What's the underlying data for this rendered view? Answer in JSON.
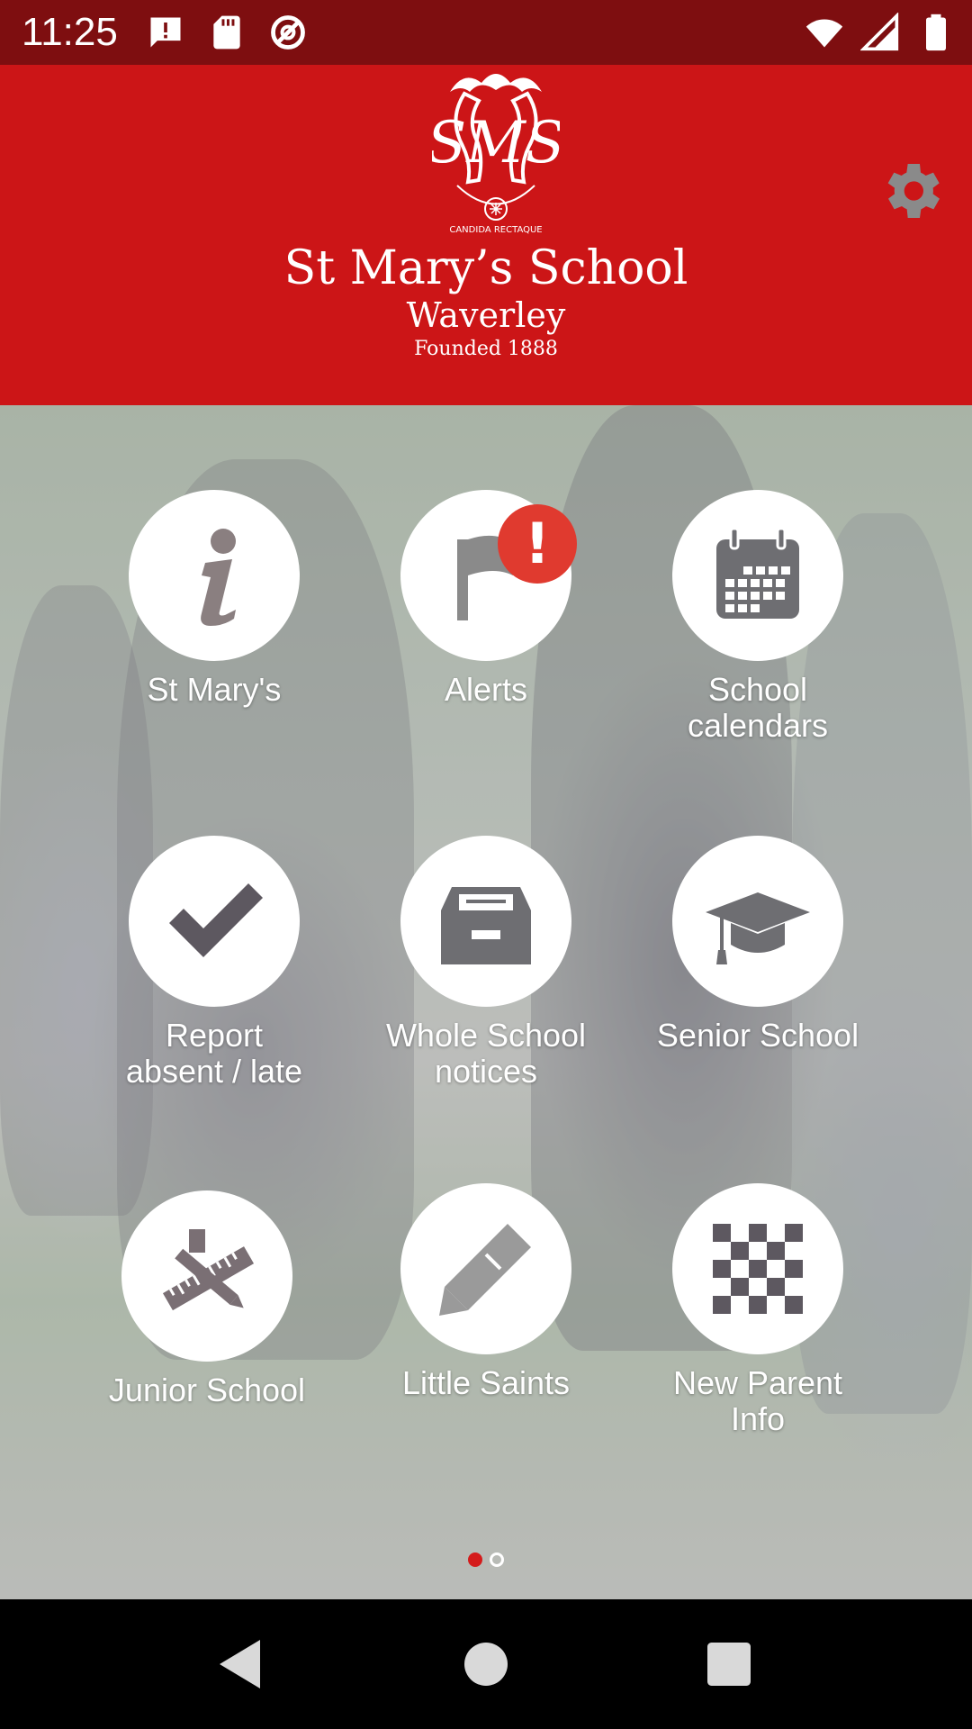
{
  "status_bar": {
    "time": "11:25",
    "left_icons": [
      "alert-message-icon",
      "sd-card-icon",
      "do-not-disturb-icon"
    ],
    "right_icons": [
      "wifi-icon",
      "signal-icon",
      "battery-icon"
    ]
  },
  "header": {
    "school_name": "St Mary’s School",
    "location": "Waverley",
    "founded": "Founded 1888",
    "crest_motto": "CANDIDA RECTAQUE",
    "crest_monogram": "SMS",
    "settings_icon": "gear-icon",
    "colors": {
      "header": "#cc1517",
      "status_bar": "#7e0e10"
    }
  },
  "tiles": [
    {
      "label": "St Mary's",
      "icon": "info-icon"
    },
    {
      "label": "Alerts",
      "icon": "flag-icon",
      "badge": "!"
    },
    {
      "label": "School\ncalendars",
      "icon": "calendar-icon"
    },
    {
      "label": "Report\nabsent / late",
      "icon": "checkmark-icon"
    },
    {
      "label": "Whole School\nnotices",
      "icon": "archive-box-icon"
    },
    {
      "label": "Senior School",
      "icon": "graduation-cap-icon"
    },
    {
      "label": "Junior School",
      "icon": "ruler-pencil-icon"
    },
    {
      "label": "Little Saints",
      "icon": "pencil-icon"
    },
    {
      "label": "New Parent\nInfo",
      "icon": "checkerboard-icon"
    }
  ],
  "pager": {
    "current_page": 1,
    "total_pages": 2
  },
  "navigation": {
    "buttons": [
      "back-icon",
      "home-icon",
      "recents-icon"
    ]
  }
}
